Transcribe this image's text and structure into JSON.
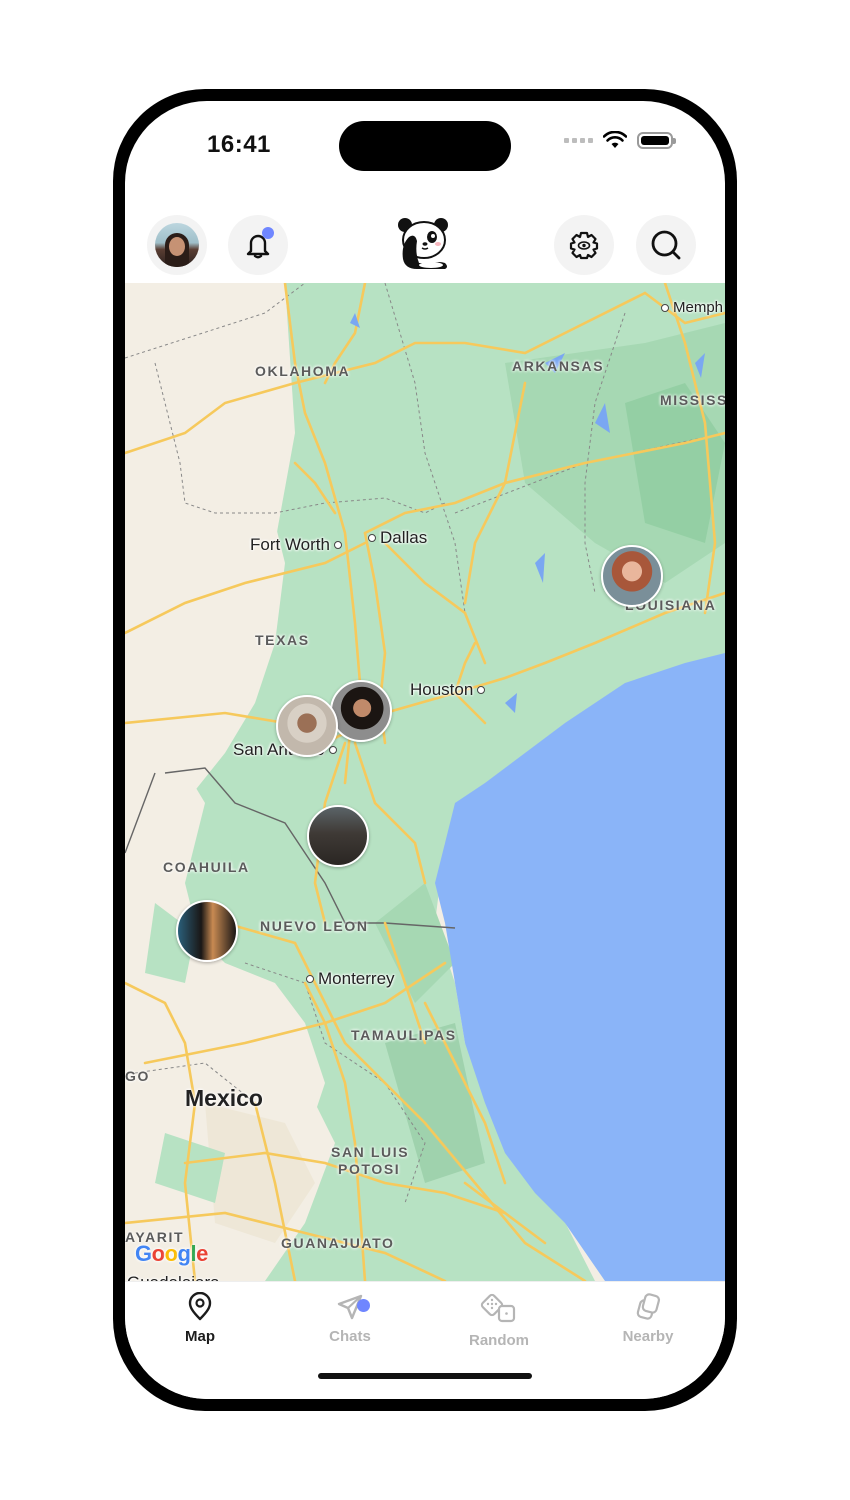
{
  "status_bar": {
    "time": "16:41",
    "signal": "weak",
    "wifi": "full",
    "battery": "full"
  },
  "header": {
    "profile_avatar": "user-avatar",
    "notifications": {
      "icon": "bell-icon",
      "has_unread": true
    },
    "logo": "panda-logo",
    "settings": {
      "icon": "gear-eye-icon"
    },
    "search": {
      "icon": "search-icon"
    }
  },
  "map": {
    "region_labels": [
      "OKLAHOMA",
      "ARKANSAS",
      "MISSISS",
      "TEXAS",
      "LOUISIANA",
      "COAHUILA",
      "NUEVO LEON",
      "TAMAULIPAS",
      "SAN LUIS",
      "POTOSI",
      "GUANAJUATO",
      "GO",
      "AYARIT"
    ],
    "cities": [
      "Memph",
      "Fort Worth",
      "Dallas",
      "Houston",
      "San Antonio",
      "Monterrey",
      "Guadalajara"
    ],
    "country_label": "Mexico",
    "attribution": "Google",
    "user_pins": [
      "user-pin-louisiana",
      "user-pin-san-antonio-1",
      "user-pin-san-antonio-2",
      "user-pin-south-texas",
      "user-pin-coahuila"
    ]
  },
  "tabs": [
    {
      "label": "Map",
      "icon": "map-pin-icon",
      "active": true
    },
    {
      "label": "Chats",
      "icon": "paper-plane-icon",
      "active": false,
      "has_unread": true
    },
    {
      "label": "Random",
      "icon": "dice-icon",
      "active": false
    },
    {
      "label": "Nearby",
      "icon": "cards-icon",
      "active": false
    }
  ],
  "colors": {
    "accent": "#6f86ff",
    "water": "#8ab4f8",
    "park": "#b7e2c3",
    "road": "#f6c95c",
    "land": "#f3eee4",
    "tab_inactive": "#b5b5b5",
    "tab_active": "#1c1c1c"
  }
}
